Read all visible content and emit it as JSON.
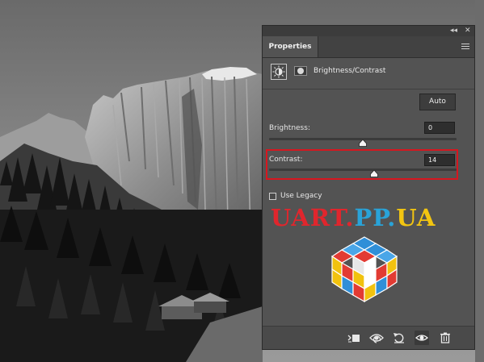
{
  "panel": {
    "collapse_glyph": "◂◂",
    "close_glyph": "✕",
    "tab_label": "Properties",
    "menu_icon": "hamburger-menu-icon",
    "adjustment_icon": "brightness-contrast-icon",
    "mask_icon": "layer-mask-icon",
    "adjustment_title": "Brightness/Contrast",
    "auto_label": "Auto",
    "brightness": {
      "label": "Brightness:",
      "value": "0",
      "level": 0.5
    },
    "contrast": {
      "label": "Contrast:",
      "value": "14",
      "level": 0.56
    },
    "use_legacy": {
      "label": "Use Legacy",
      "checked": false
    },
    "highlight_color": "#d7161f",
    "bottom_icons": [
      "clip-to-layer-icon",
      "view-previous-state-icon",
      "reset-icon",
      "toggle-visibility-icon",
      "delete-icon"
    ]
  },
  "watermark": {
    "text": "UART.PP.UA",
    "colors": [
      "#e0262d",
      "#e0262d",
      "#e0262d",
      "#e0262d",
      "#e0262d",
      "#29a3d8",
      "#29a3d8",
      "#29a3d8",
      "#f2c511",
      "#f2c511"
    ]
  }
}
